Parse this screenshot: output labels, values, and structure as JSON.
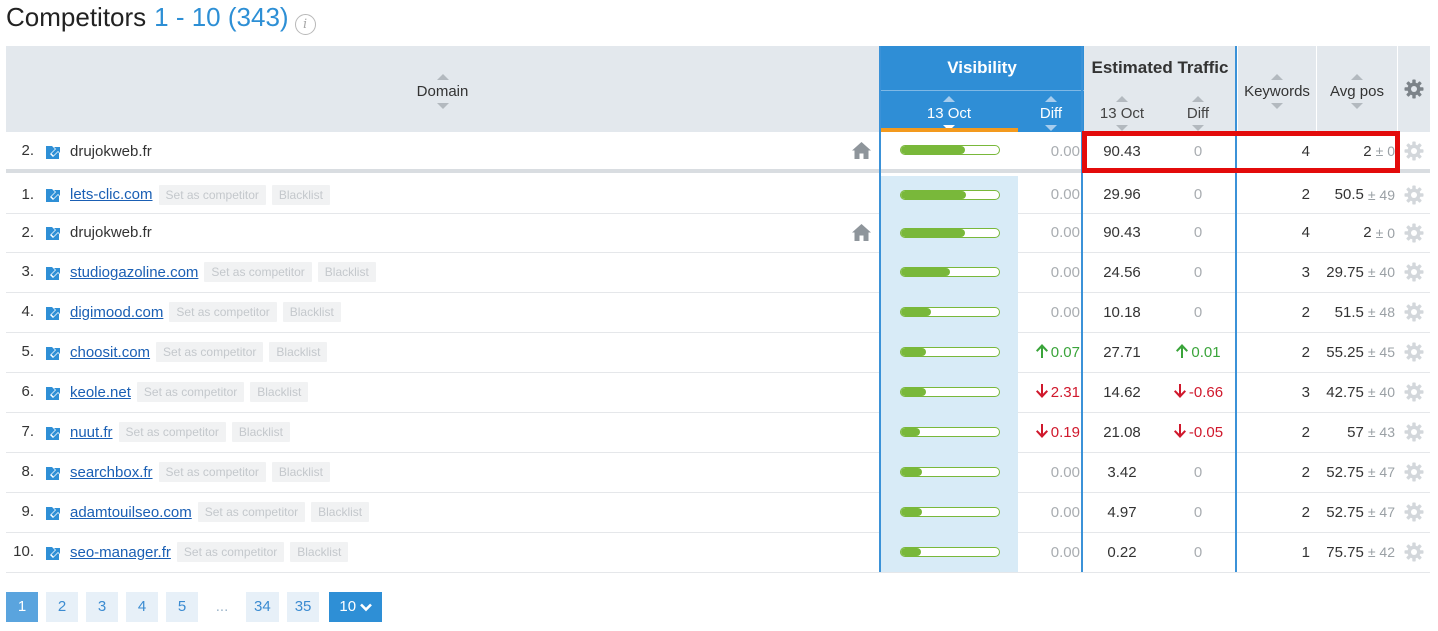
{
  "header": {
    "title": "Competitors",
    "range": "1 - 10",
    "total": "(343)",
    "info_icon": "info-icon"
  },
  "table": {
    "columns": {
      "domain": "Domain",
      "visibility_group": "Visibility",
      "visibility_date": "13 Oct",
      "visibility_diff": "Diff",
      "traffic_group": "Estimated Traffic",
      "traffic_date": "13 Oct",
      "traffic_diff": "Diff",
      "keywords": "Keywords",
      "avg_pos": "Avg pos"
    },
    "own": {
      "rank": "2.",
      "domain": "drujokweb.fr",
      "visibility_fraction": 0.65,
      "vis_diff": "0.00",
      "traffic": "90.43",
      "traffic_diff": "0",
      "keywords": "4",
      "avg_pos": "2",
      "avg_pos_pm": "± 0"
    },
    "actions": {
      "set_competitor": "Set as competitor",
      "blacklist": "Blacklist"
    },
    "rows": [
      {
        "rank": "1.",
        "domain": "lets-clic.com",
        "is_link": true,
        "visibility_fraction": 0.66,
        "vis_diff": "0.00",
        "vis_trend": "none",
        "traffic": "29.96",
        "traffic_diff": "0",
        "traffic_trend": "none",
        "keywords": "2",
        "avg_pos": "50.5",
        "avg_pos_pm": "± 49"
      },
      {
        "rank": "2.",
        "domain": "drujokweb.fr",
        "is_link": false,
        "visibility_fraction": 0.65,
        "vis_diff": "0.00",
        "vis_trend": "none",
        "traffic": "90.43",
        "traffic_diff": "0",
        "traffic_trend": "none",
        "keywords": "4",
        "avg_pos": "2",
        "avg_pos_pm": "± 0"
      },
      {
        "rank": "3.",
        "domain": "studiogazoline.com",
        "is_link": true,
        "visibility_fraction": 0.5,
        "vis_diff": "0.00",
        "vis_trend": "none",
        "traffic": "24.56",
        "traffic_diff": "0",
        "traffic_trend": "none",
        "keywords": "3",
        "avg_pos": "29.75",
        "avg_pos_pm": "± 40"
      },
      {
        "rank": "4.",
        "domain": "digimood.com",
        "is_link": true,
        "visibility_fraction": 0.31,
        "vis_diff": "0.00",
        "vis_trend": "none",
        "traffic": "10.18",
        "traffic_diff": "0",
        "traffic_trend": "none",
        "keywords": "2",
        "avg_pos": "51.5",
        "avg_pos_pm": "± 48"
      },
      {
        "rank": "5.",
        "domain": "choosit.com",
        "is_link": true,
        "visibility_fraction": 0.26,
        "vis_diff": "0.07",
        "vis_trend": "up",
        "traffic": "27.71",
        "traffic_diff": "0.01",
        "traffic_trend": "up",
        "keywords": "2",
        "avg_pos": "55.25",
        "avg_pos_pm": "± 45"
      },
      {
        "rank": "6.",
        "domain": "keole.net",
        "is_link": true,
        "visibility_fraction": 0.25,
        "vis_diff": "2.31",
        "vis_trend": "down",
        "traffic": "14.62",
        "traffic_diff": "-0.66",
        "traffic_trend": "down",
        "keywords": "3",
        "avg_pos": "42.75",
        "avg_pos_pm": "± 40"
      },
      {
        "rank": "7.",
        "domain": "nuut.fr",
        "is_link": true,
        "visibility_fraction": 0.19,
        "vis_diff": "0.19",
        "vis_trend": "down",
        "traffic": "21.08",
        "traffic_diff": "-0.05",
        "traffic_trend": "down",
        "keywords": "2",
        "avg_pos": "57",
        "avg_pos_pm": "± 43"
      },
      {
        "rank": "8.",
        "domain": "searchbox.fr",
        "is_link": true,
        "visibility_fraction": 0.21,
        "vis_diff": "0.00",
        "vis_trend": "none",
        "traffic": "3.42",
        "traffic_diff": "0",
        "traffic_trend": "none",
        "keywords": "2",
        "avg_pos": "52.75",
        "avg_pos_pm": "± 47"
      },
      {
        "rank": "9.",
        "domain": "adamtouilseo.com",
        "is_link": true,
        "visibility_fraction": 0.21,
        "vis_diff": "0.00",
        "vis_trend": "none",
        "traffic": "4.97",
        "traffic_diff": "0",
        "traffic_trend": "none",
        "keywords": "2",
        "avg_pos": "52.75",
        "avg_pos_pm": "± 47"
      },
      {
        "rank": "10.",
        "domain": "seo-manager.fr",
        "is_link": true,
        "visibility_fraction": 0.2,
        "vis_diff": "0.00",
        "vis_trend": "none",
        "traffic": "0.22",
        "traffic_diff": "0",
        "traffic_trend": "none",
        "keywords": "1",
        "avg_pos": "75.75",
        "avg_pos_pm": "± 42"
      }
    ]
  },
  "pagination": {
    "pages": [
      "1",
      "2",
      "3",
      "4",
      "5",
      "...",
      "34",
      "35"
    ],
    "active": "1",
    "per_page": "10"
  },
  "colors": {
    "accent": "#2f8ed6",
    "bar": "#79b83a",
    "up": "#3aa43a",
    "down": "#d0182c",
    "highlight": "#e30b0b",
    "sort_active": "#f39a1e"
  }
}
